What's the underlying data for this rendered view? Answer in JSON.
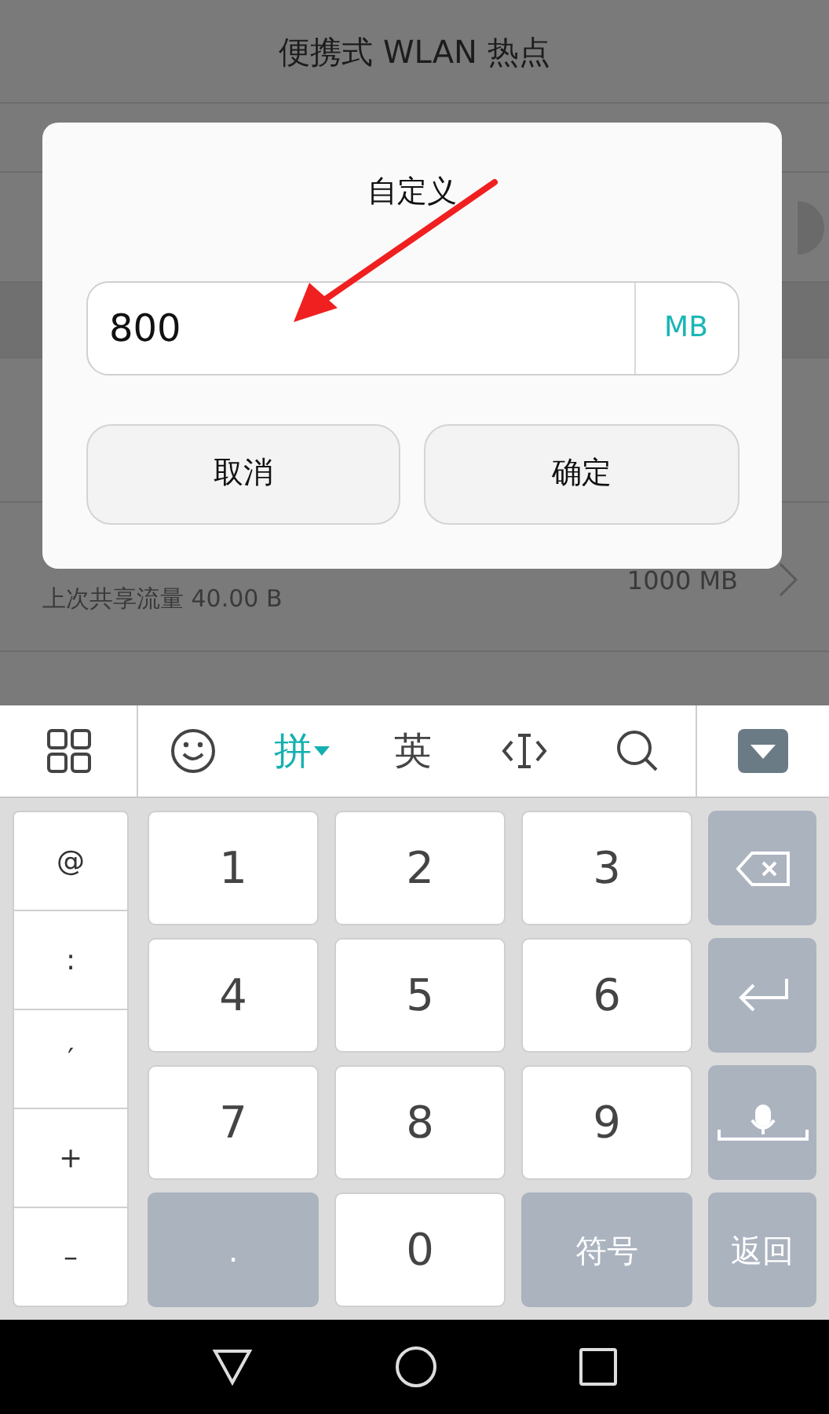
{
  "screen_title": "便携式 WLAN 热点",
  "background_row": {
    "value": "1000 MB",
    "subtitle": "上次共享流量 40.00 B"
  },
  "dialog": {
    "title": "自定义",
    "input": {
      "value": "800",
      "unit": "MB"
    },
    "buttons": [
      "取消",
      "确定"
    ]
  },
  "keyboard": {
    "toolbar": [
      {
        "kind": "grid"
      },
      {
        "kind": "emoji"
      },
      {
        "kind": "text",
        "label": "拼",
        "selected": true
      },
      {
        "kind": "text",
        "label": "英",
        "selected": false
      },
      {
        "kind": "cursor"
      },
      {
        "kind": "search"
      },
      {
        "kind": "hide"
      }
    ],
    "side_keys": [
      "@",
      ":",
      "′",
      "+",
      "–"
    ],
    "keys": [
      {
        "kind": "white",
        "label": "1"
      },
      {
        "kind": "white",
        "label": "2"
      },
      {
        "kind": "white",
        "label": "3"
      },
      {
        "kind": "backspace"
      },
      {
        "kind": "white",
        "label": "4"
      },
      {
        "kind": "white",
        "label": "5"
      },
      {
        "kind": "white",
        "label": "6"
      },
      {
        "kind": "enter"
      },
      {
        "kind": "white",
        "label": "7"
      },
      {
        "kind": "white",
        "label": "8"
      },
      {
        "kind": "white",
        "label": "9"
      },
      {
        "kind": "voice"
      },
      {
        "kind": "gray",
        "label": "."
      },
      {
        "kind": "white",
        "label": "0"
      },
      {
        "kind": "gray",
        "label": "符号"
      },
      {
        "kind": "gray",
        "label": "返回"
      }
    ]
  }
}
